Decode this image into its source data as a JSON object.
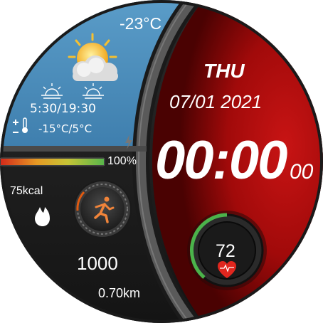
{
  "weather": {
    "temperature": "-23°C",
    "sun_times": "5:30/19:30",
    "temp_range": "-15°C/5°C",
    "icon": "partly-cloudy-icon"
  },
  "battery": {
    "label": "100%",
    "level": 1.0
  },
  "activity": {
    "calories": "75kcal",
    "steps": "1000",
    "distance": "0.70km"
  },
  "clock": {
    "day": "THU",
    "date": "07/01 2021",
    "time": "00:00",
    "seconds": "00"
  },
  "heart": {
    "rate": "72"
  },
  "colors": {
    "weather_panel": "#4b90bd",
    "accent_red": "#c41010",
    "bezel": "#3a3a3a",
    "ring_green": "#4bb34b"
  }
}
